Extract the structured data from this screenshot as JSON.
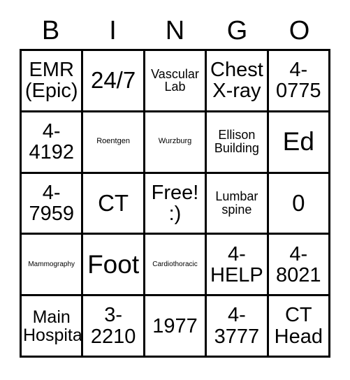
{
  "card": {
    "title_letters": [
      "B",
      "I",
      "N",
      "G",
      "O"
    ],
    "free_space_index": 12,
    "colors": {
      "ink": "#000000",
      "paper": "#ffffff",
      "grid_line": "#000000"
    },
    "rows": [
      [
        {
          "text": "EMR\n(Epic)",
          "size": "lg"
        },
        {
          "text": "24/7",
          "size": "xl"
        },
        {
          "text": "Vascular\nLab",
          "size": "sm"
        },
        {
          "text": "Chest\nX-ray",
          "size": "lg"
        },
        {
          "text": "4-\n0775",
          "size": "lg"
        }
      ],
      [
        {
          "text": "4-\n4192",
          "size": "lg"
        },
        {
          "text": "Roentgen",
          "size": "tiny"
        },
        {
          "text": "Wurzburg",
          "size": "tiny"
        },
        {
          "text": "Ellison\nBuilding",
          "size": "sm"
        },
        {
          "text": "Ed",
          "size": "xxl"
        }
      ],
      [
        {
          "text": "4-\n7959",
          "size": "lg"
        },
        {
          "text": "CT",
          "size": "xl"
        },
        {
          "text": "Free!\n:)",
          "size": "lg"
        },
        {
          "text": "Lumbar\nspine",
          "size": "sm"
        },
        {
          "text": "0",
          "size": "xl"
        }
      ],
      [
        {
          "text": "Mammography",
          "size": "micro"
        },
        {
          "text": "Foot",
          "size": "xxl"
        },
        {
          "text": "Cardiothoracic",
          "size": "micro"
        },
        {
          "text": "4-\nHELP",
          "size": "lg"
        },
        {
          "text": "4-\n8021",
          "size": "lg"
        }
      ],
      [
        {
          "text": "Main\nHospital",
          "size": "md"
        },
        {
          "text": "3-\n2210",
          "size": "lg"
        },
        {
          "text": "1977",
          "size": "lg"
        },
        {
          "text": "4-\n3777",
          "size": "lg"
        },
        {
          "text": "CT\nHead",
          "size": "lg"
        }
      ]
    ]
  }
}
